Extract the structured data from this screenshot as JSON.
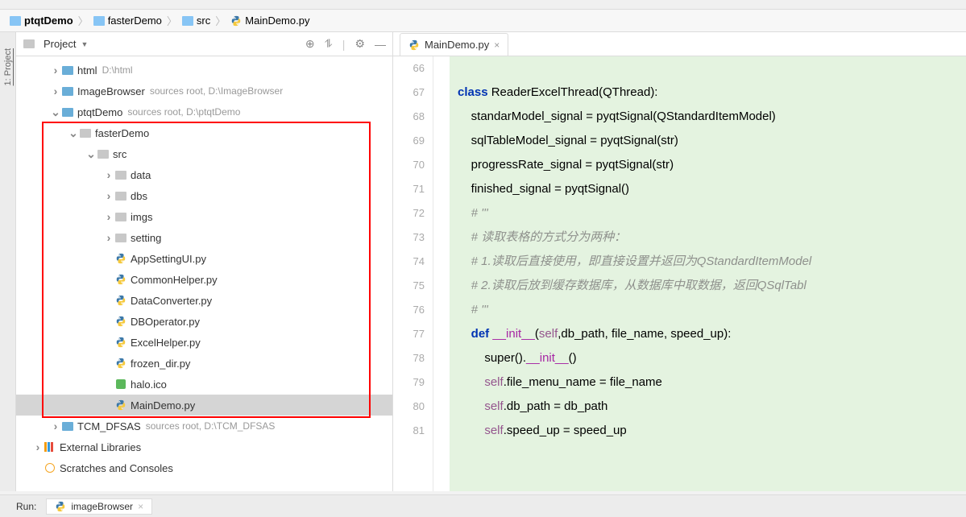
{
  "breadcrumb": {
    "items": [
      {
        "label": "ptqtDemo",
        "icon": "folder"
      },
      {
        "label": "fasterDemo",
        "icon": "folder"
      },
      {
        "label": "src",
        "icon": "folder"
      },
      {
        "label": "MainDemo.py",
        "icon": "python"
      }
    ]
  },
  "leftGutter": {
    "label": "1: Project"
  },
  "projectPanel": {
    "title": "Project",
    "toolbarIcons": [
      "target",
      "collapse",
      "divider",
      "gear",
      "hide"
    ]
  },
  "tree": [
    {
      "depth": 0,
      "arrow": "right",
      "icon": "folder-blue",
      "label": "html",
      "hint": "D:\\html"
    },
    {
      "depth": 0,
      "arrow": "right",
      "icon": "folder-blue",
      "label": "ImageBrowser",
      "hint": "sources root,  D:\\ImageBrowser"
    },
    {
      "depth": 0,
      "arrow": "down",
      "icon": "folder-blue",
      "label": "ptqtDemo",
      "hint": "sources root,  D:\\ptqtDemo"
    },
    {
      "depth": 1,
      "arrow": "down",
      "icon": "folder-grey",
      "label": "fasterDemo",
      "hint": ""
    },
    {
      "depth": 2,
      "arrow": "down",
      "icon": "folder-grey",
      "label": "src",
      "hint": ""
    },
    {
      "depth": 3,
      "arrow": "right",
      "icon": "folder-grey",
      "label": "data",
      "hint": ""
    },
    {
      "depth": 3,
      "arrow": "right",
      "icon": "folder-grey",
      "label": "dbs",
      "hint": ""
    },
    {
      "depth": 3,
      "arrow": "right",
      "icon": "folder-grey",
      "label": "imgs",
      "hint": ""
    },
    {
      "depth": 3,
      "arrow": "right",
      "icon": "folder-grey",
      "label": "setting",
      "hint": ""
    },
    {
      "depth": 3,
      "arrow": "",
      "icon": "python",
      "label": "AppSettingUI.py",
      "hint": ""
    },
    {
      "depth": 3,
      "arrow": "",
      "icon": "python",
      "label": "CommonHelper.py",
      "hint": ""
    },
    {
      "depth": 3,
      "arrow": "",
      "icon": "python",
      "label": "DataConverter.py",
      "hint": ""
    },
    {
      "depth": 3,
      "arrow": "",
      "icon": "python",
      "label": "DBOperator.py",
      "hint": ""
    },
    {
      "depth": 3,
      "arrow": "",
      "icon": "python",
      "label": "ExcelHelper.py",
      "hint": ""
    },
    {
      "depth": 3,
      "arrow": "",
      "icon": "python",
      "label": "frozen_dir.py",
      "hint": ""
    },
    {
      "depth": 3,
      "arrow": "",
      "icon": "ico",
      "label": "halo.ico",
      "hint": ""
    },
    {
      "depth": 3,
      "arrow": "",
      "icon": "python",
      "label": "MainDemo.py",
      "hint": "",
      "selected": true
    },
    {
      "depth": 0,
      "arrow": "right",
      "icon": "folder-blue",
      "label": "TCM_DFSAS",
      "hint": "sources root,  D:\\TCM_DFSAS"
    },
    {
      "depth": -1,
      "arrow": "right",
      "icon": "lib",
      "label": "External Libraries",
      "hint": ""
    },
    {
      "depth": -1,
      "arrow": "",
      "icon": "scratch",
      "label": "Scratches and Consoles",
      "hint": ""
    }
  ],
  "editor": {
    "tab": {
      "label": "MainDemo.py"
    },
    "startLine": 66,
    "lines": [
      {
        "n": 66,
        "html": ""
      },
      {
        "n": 67,
        "html": "<span class='kw'>class</span> <span class='cls'>ReaderExcelThread</span>(QThread):"
      },
      {
        "n": 68,
        "html": "    standarModel_signal = pyqtSignal(QStandardItemModel)"
      },
      {
        "n": 69,
        "html": "    sqlTableModel_signal = pyqtSignal(<span class='builtin'>str</span>)"
      },
      {
        "n": 70,
        "html": "    progressRate_signal = pyqtSignal(<span class='builtin'>str</span>)"
      },
      {
        "n": 71,
        "html": "    finished_signal = pyqtSignal()"
      },
      {
        "n": 72,
        "html": "    <span class='cm'># '''</span>"
      },
      {
        "n": 73,
        "html": "    <span class='cm'># 读取表格的方式分为两种：</span>"
      },
      {
        "n": 74,
        "html": "    <span class='cm'># 1.读取后直接使用，即直接设置并返回为QStandardItemModel</span>"
      },
      {
        "n": 75,
        "html": "    <span class='cm'># 2.读取后放到缓存数据库，从数据库中取数据，返回QSqlTabl</span>"
      },
      {
        "n": 76,
        "html": "    <span class='cm'># '''</span>"
      },
      {
        "n": 77,
        "html": "    <span class='kw'>def</span> <span class='dunder'>__init__</span>(<span class='self'>self</span>,db_path, file_name, speed_up):"
      },
      {
        "n": 78,
        "html": "        <span class='builtin'>super</span>().<span class='dunder'>__init__</span>()"
      },
      {
        "n": 79,
        "html": "        <span class='self'>self</span>.file_menu_name = file_name"
      },
      {
        "n": 80,
        "html": "        <span class='self'>self</span>.db_path = db_path"
      },
      {
        "n": 81,
        "html": "        <span class='self'>self</span>.speed_up = speed_up"
      }
    ]
  },
  "bottomBar": {
    "runLabel": "Run:",
    "tabLabel": "imageBrowser"
  }
}
